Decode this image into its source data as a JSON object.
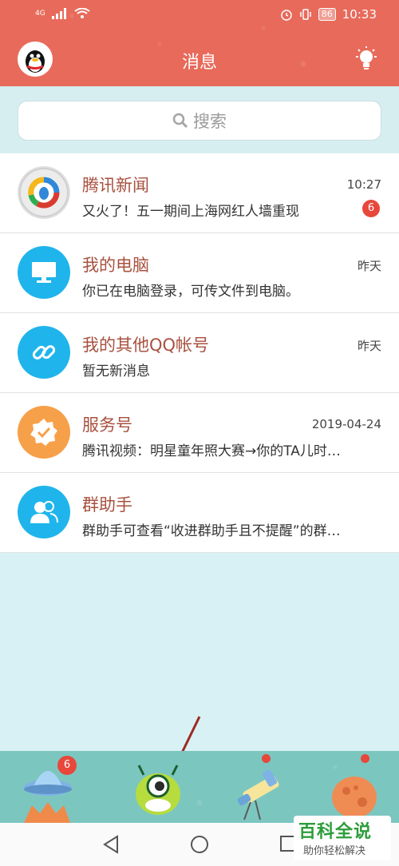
{
  "status_bar": {
    "network": "4G",
    "battery": "86",
    "time": "10:33"
  },
  "header": {
    "title": "消息"
  },
  "search": {
    "placeholder": "搜索"
  },
  "conversations": [
    {
      "title": "腾讯新闻",
      "subtitle": "又火了！五一期间上海网红人墙重现",
      "time": "10:27",
      "badge": "6",
      "icon": "tencent-news-icon",
      "color": "#d0d0d0"
    },
    {
      "title": "我的电脑",
      "subtitle": "你已在电脑登录，可传文件到电脑。",
      "time": "昨天",
      "badge": "",
      "icon": "computer-icon",
      "color": "#1fb5ec"
    },
    {
      "title": "我的其他QQ帐号",
      "subtitle": "暂无新消息",
      "time": "昨天",
      "badge": "",
      "icon": "link-icon",
      "color": "#1fb5ec"
    },
    {
      "title": "服务号",
      "subtitle": "腾讯视频：明星童年照大赛→你的TA儿时…",
      "time": "2019-04-24",
      "badge": "",
      "icon": "badge-check-icon",
      "color": "#f7a04a"
    },
    {
      "title": "群助手",
      "subtitle": "群助手可查看“收进群助手且不提醒”的群…",
      "time": "",
      "badge": "",
      "icon": "group-icon",
      "color": "#1fb5ec"
    }
  ],
  "tabbar": {
    "messages_badge": "6"
  },
  "watermark": {
    "brand": "百科全说",
    "slogan": "助你轻松解决"
  }
}
